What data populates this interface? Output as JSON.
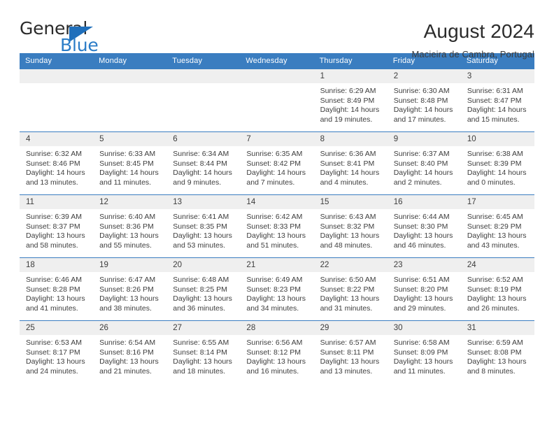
{
  "brand": {
    "name_part1": "General",
    "name_part2": "Blue",
    "mark": "triangle-icon"
  },
  "header": {
    "title": "August 2024",
    "subtitle": "Macieira de Cambra, Portugal"
  },
  "calendar": {
    "weekday_headers": [
      "Sunday",
      "Monday",
      "Tuesday",
      "Wednesday",
      "Thursday",
      "Friday",
      "Saturday"
    ],
    "accent_color": "#3a7dc0",
    "daynum_background": "#efefef",
    "weeks": [
      [
        {
          "day": "",
          "sunrise": "",
          "sunset": "",
          "daylight_line1": "",
          "daylight_line2": ""
        },
        {
          "day": "",
          "sunrise": "",
          "sunset": "",
          "daylight_line1": "",
          "daylight_line2": ""
        },
        {
          "day": "",
          "sunrise": "",
          "sunset": "",
          "daylight_line1": "",
          "daylight_line2": ""
        },
        {
          "day": "",
          "sunrise": "",
          "sunset": "",
          "daylight_line1": "",
          "daylight_line2": ""
        },
        {
          "day": "1",
          "sunrise": "Sunrise: 6:29 AM",
          "sunset": "Sunset: 8:49 PM",
          "daylight_line1": "Daylight: 14 hours",
          "daylight_line2": "and 19 minutes."
        },
        {
          "day": "2",
          "sunrise": "Sunrise: 6:30 AM",
          "sunset": "Sunset: 8:48 PM",
          "daylight_line1": "Daylight: 14 hours",
          "daylight_line2": "and 17 minutes."
        },
        {
          "day": "3",
          "sunrise": "Sunrise: 6:31 AM",
          "sunset": "Sunset: 8:47 PM",
          "daylight_line1": "Daylight: 14 hours",
          "daylight_line2": "and 15 minutes."
        }
      ],
      [
        {
          "day": "4",
          "sunrise": "Sunrise: 6:32 AM",
          "sunset": "Sunset: 8:46 PM",
          "daylight_line1": "Daylight: 14 hours",
          "daylight_line2": "and 13 minutes."
        },
        {
          "day": "5",
          "sunrise": "Sunrise: 6:33 AM",
          "sunset": "Sunset: 8:45 PM",
          "daylight_line1": "Daylight: 14 hours",
          "daylight_line2": "and 11 minutes."
        },
        {
          "day": "6",
          "sunrise": "Sunrise: 6:34 AM",
          "sunset": "Sunset: 8:44 PM",
          "daylight_line1": "Daylight: 14 hours",
          "daylight_line2": "and 9 minutes."
        },
        {
          "day": "7",
          "sunrise": "Sunrise: 6:35 AM",
          "sunset": "Sunset: 8:42 PM",
          "daylight_line1": "Daylight: 14 hours",
          "daylight_line2": "and 7 minutes."
        },
        {
          "day": "8",
          "sunrise": "Sunrise: 6:36 AM",
          "sunset": "Sunset: 8:41 PM",
          "daylight_line1": "Daylight: 14 hours",
          "daylight_line2": "and 4 minutes."
        },
        {
          "day": "9",
          "sunrise": "Sunrise: 6:37 AM",
          "sunset": "Sunset: 8:40 PM",
          "daylight_line1": "Daylight: 14 hours",
          "daylight_line2": "and 2 minutes."
        },
        {
          "day": "10",
          "sunrise": "Sunrise: 6:38 AM",
          "sunset": "Sunset: 8:39 PM",
          "daylight_line1": "Daylight: 14 hours",
          "daylight_line2": "and 0 minutes."
        }
      ],
      [
        {
          "day": "11",
          "sunrise": "Sunrise: 6:39 AM",
          "sunset": "Sunset: 8:37 PM",
          "daylight_line1": "Daylight: 13 hours",
          "daylight_line2": "and 58 minutes."
        },
        {
          "day": "12",
          "sunrise": "Sunrise: 6:40 AM",
          "sunset": "Sunset: 8:36 PM",
          "daylight_line1": "Daylight: 13 hours",
          "daylight_line2": "and 55 minutes."
        },
        {
          "day": "13",
          "sunrise": "Sunrise: 6:41 AM",
          "sunset": "Sunset: 8:35 PM",
          "daylight_line1": "Daylight: 13 hours",
          "daylight_line2": "and 53 minutes."
        },
        {
          "day": "14",
          "sunrise": "Sunrise: 6:42 AM",
          "sunset": "Sunset: 8:33 PM",
          "daylight_line1": "Daylight: 13 hours",
          "daylight_line2": "and 51 minutes."
        },
        {
          "day": "15",
          "sunrise": "Sunrise: 6:43 AM",
          "sunset": "Sunset: 8:32 PM",
          "daylight_line1": "Daylight: 13 hours",
          "daylight_line2": "and 48 minutes."
        },
        {
          "day": "16",
          "sunrise": "Sunrise: 6:44 AM",
          "sunset": "Sunset: 8:30 PM",
          "daylight_line1": "Daylight: 13 hours",
          "daylight_line2": "and 46 minutes."
        },
        {
          "day": "17",
          "sunrise": "Sunrise: 6:45 AM",
          "sunset": "Sunset: 8:29 PM",
          "daylight_line1": "Daylight: 13 hours",
          "daylight_line2": "and 43 minutes."
        }
      ],
      [
        {
          "day": "18",
          "sunrise": "Sunrise: 6:46 AM",
          "sunset": "Sunset: 8:28 PM",
          "daylight_line1": "Daylight: 13 hours",
          "daylight_line2": "and 41 minutes."
        },
        {
          "day": "19",
          "sunrise": "Sunrise: 6:47 AM",
          "sunset": "Sunset: 8:26 PM",
          "daylight_line1": "Daylight: 13 hours",
          "daylight_line2": "and 38 minutes."
        },
        {
          "day": "20",
          "sunrise": "Sunrise: 6:48 AM",
          "sunset": "Sunset: 8:25 PM",
          "daylight_line1": "Daylight: 13 hours",
          "daylight_line2": "and 36 minutes."
        },
        {
          "day": "21",
          "sunrise": "Sunrise: 6:49 AM",
          "sunset": "Sunset: 8:23 PM",
          "daylight_line1": "Daylight: 13 hours",
          "daylight_line2": "and 34 minutes."
        },
        {
          "day": "22",
          "sunrise": "Sunrise: 6:50 AM",
          "sunset": "Sunset: 8:22 PM",
          "daylight_line1": "Daylight: 13 hours",
          "daylight_line2": "and 31 minutes."
        },
        {
          "day": "23",
          "sunrise": "Sunrise: 6:51 AM",
          "sunset": "Sunset: 8:20 PM",
          "daylight_line1": "Daylight: 13 hours",
          "daylight_line2": "and 29 minutes."
        },
        {
          "day": "24",
          "sunrise": "Sunrise: 6:52 AM",
          "sunset": "Sunset: 8:19 PM",
          "daylight_line1": "Daylight: 13 hours",
          "daylight_line2": "and 26 minutes."
        }
      ],
      [
        {
          "day": "25",
          "sunrise": "Sunrise: 6:53 AM",
          "sunset": "Sunset: 8:17 PM",
          "daylight_line1": "Daylight: 13 hours",
          "daylight_line2": "and 24 minutes."
        },
        {
          "day": "26",
          "sunrise": "Sunrise: 6:54 AM",
          "sunset": "Sunset: 8:16 PM",
          "daylight_line1": "Daylight: 13 hours",
          "daylight_line2": "and 21 minutes."
        },
        {
          "day": "27",
          "sunrise": "Sunrise: 6:55 AM",
          "sunset": "Sunset: 8:14 PM",
          "daylight_line1": "Daylight: 13 hours",
          "daylight_line2": "and 18 minutes."
        },
        {
          "day": "28",
          "sunrise": "Sunrise: 6:56 AM",
          "sunset": "Sunset: 8:12 PM",
          "daylight_line1": "Daylight: 13 hours",
          "daylight_line2": "and 16 minutes."
        },
        {
          "day": "29",
          "sunrise": "Sunrise: 6:57 AM",
          "sunset": "Sunset: 8:11 PM",
          "daylight_line1": "Daylight: 13 hours",
          "daylight_line2": "and 13 minutes."
        },
        {
          "day": "30",
          "sunrise": "Sunrise: 6:58 AM",
          "sunset": "Sunset: 8:09 PM",
          "daylight_line1": "Daylight: 13 hours",
          "daylight_line2": "and 11 minutes."
        },
        {
          "day": "31",
          "sunrise": "Sunrise: 6:59 AM",
          "sunset": "Sunset: 8:08 PM",
          "daylight_line1": "Daylight: 13 hours",
          "daylight_line2": "and 8 minutes."
        }
      ]
    ]
  }
}
